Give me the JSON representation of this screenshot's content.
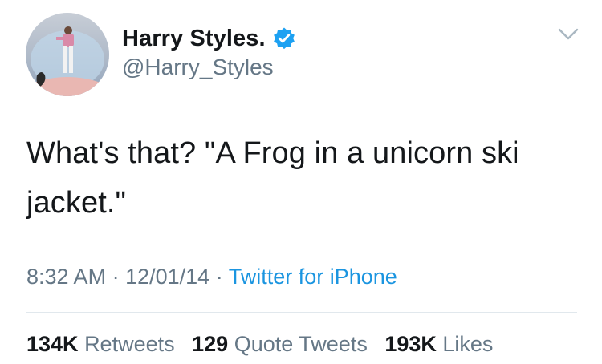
{
  "author": {
    "display_name": "Harry Styles.",
    "handle": "@Harry_Styles",
    "verified": true,
    "avatar_icon": "profile-photo"
  },
  "tweet": {
    "text": "What's that? \"A Frog in a unicorn ski jacket.\""
  },
  "meta": {
    "time": "8:32 AM",
    "separator": "·",
    "date": "12/01/14",
    "source": "Twitter for iPhone"
  },
  "stats": {
    "retweets_count": "134K",
    "retweets_label": "Retweets",
    "quotes_count": "129",
    "quotes_label": "Quote Tweets",
    "likes_count": "193K",
    "likes_label": "Likes"
  },
  "colors": {
    "text": "#14171a",
    "secondary": "#657786",
    "accent": "#1b95e0",
    "divider": "#e1e8ed",
    "verified": "#1da1f2"
  }
}
